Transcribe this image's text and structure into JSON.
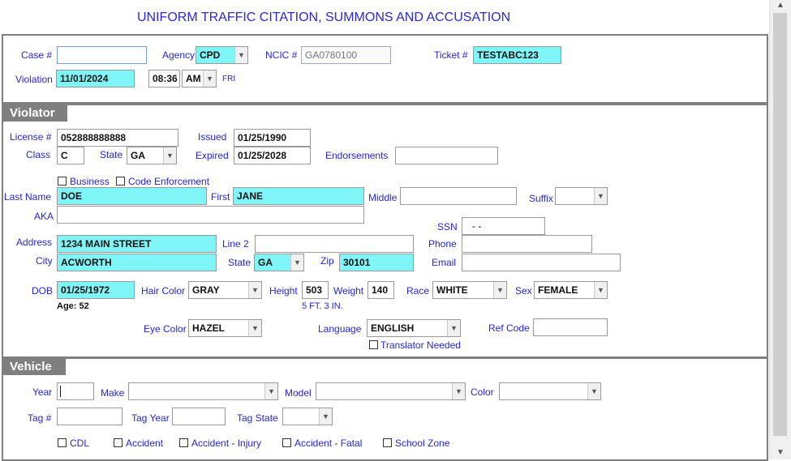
{
  "title": "UNIFORM TRAFFIC CITATION, SUMMONS AND ACCUSATION",
  "header": {
    "case_label": "Case #",
    "case_value": "",
    "agency_label": "Agency",
    "agency_value": "CPD",
    "ncic_label": "NCIC #",
    "ncic_value": "GA0780100",
    "ticket_label": "Ticket #",
    "ticket_value": "TESTABC123",
    "violation_label": "Violation",
    "violation_date": "11/01/2024",
    "violation_time": "08:36",
    "violation_ampm": "AM",
    "violation_day": "FRI"
  },
  "violator": {
    "section_title": "Violator",
    "license_label": "License #",
    "license_value": "052888888888",
    "issued_label": "Issued",
    "issued_value": "01/25/1990",
    "class_label": "Class",
    "class_value": "C",
    "state_label": "State",
    "state_value": "GA",
    "expired_label": "Expired",
    "expired_value": "01/25/2028",
    "endorsements_label": "Endorsements",
    "endorsements_value": "",
    "business_label": "Business",
    "code_enforcement_label": "Code Enforcement",
    "last_name_label": "Last Name",
    "last_name_value": "DOE",
    "first_label": "First",
    "first_value": "JANE",
    "middle_label": "Middle",
    "middle_value": "",
    "suffix_label": "Suffix",
    "suffix_value": "",
    "aka_label": "AKA",
    "aka_value": "",
    "ssn_label": "SSN",
    "ssn_value": "- -",
    "address_label": "Address",
    "address_value": "1234 MAIN STREET",
    "line2_label": "Line 2",
    "line2_value": "",
    "phone_label": "Phone",
    "phone_value": "",
    "city_label": "City",
    "city_value": "ACWORTH",
    "addr_state_label": "State",
    "addr_state_value": "GA",
    "zip_label": "Zip",
    "zip_value": "30101",
    "email_label": "Email",
    "email_value": "",
    "dob_label": "DOB",
    "dob_value": "01/25/1972",
    "age_text": "Age: 52",
    "hair_color_label": "Hair Color",
    "hair_color_value": "GRAY",
    "height_label": "Height",
    "height_value": "503",
    "height_text": "5 FT. 3 IN.",
    "weight_label": "Weight",
    "weight_value": "140",
    "race_label": "Race",
    "race_value": "WHITE",
    "sex_label": "Sex",
    "sex_value": "FEMALE",
    "eye_color_label": "Eye Color",
    "eye_color_value": "HAZEL",
    "language_label": "Language",
    "language_value": "ENGLISH",
    "ref_code_label": "Ref Code",
    "ref_code_value": "",
    "translator_label": "Translator Needed"
  },
  "vehicle": {
    "section_title": "Vehicle",
    "year_label": "Year",
    "year_value": "",
    "make_label": "Make",
    "make_value": "",
    "model_label": "Model",
    "model_value": "",
    "color_label": "Color",
    "color_value": "",
    "tag_label": "Tag #",
    "tag_value": "",
    "tag_year_label": "Tag Year",
    "tag_year_value": "",
    "tag_state_label": "Tag State",
    "tag_state_value": "",
    "cdl_label": "CDL",
    "accident_label": "Accident",
    "accident_injury_label": "Accident - Injury",
    "accident_fatal_label": "Accident - Fatal",
    "school_zone_label": "School Zone"
  },
  "icons": {
    "dropdown": "chevron-down-icon",
    "scroll_up": "scroll-up-icon",
    "scroll_down": "scroll-down-icon"
  },
  "colors": {
    "label_blue": "#2626d9",
    "highlight_cyan": "#7ff5f7",
    "section_gray": "#7f7f7f"
  }
}
